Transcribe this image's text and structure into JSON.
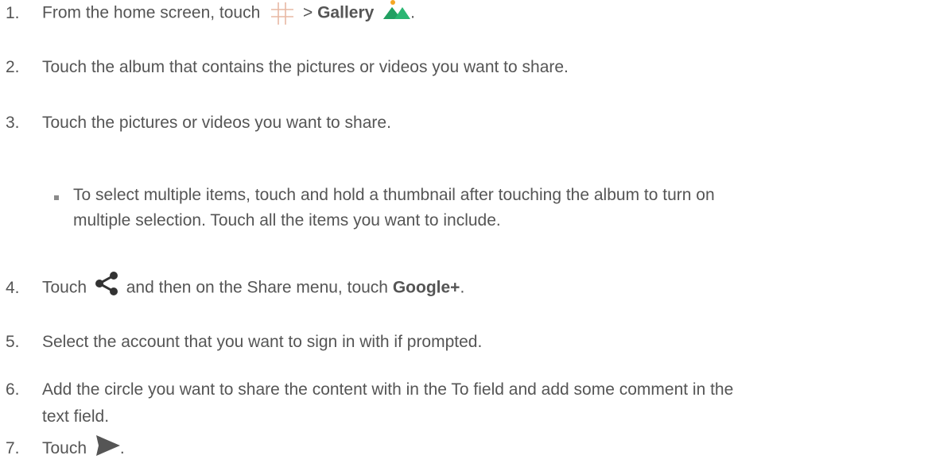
{
  "steps": [
    {
      "num": "1.",
      "pre": "From the home screen, touch",
      "sep": ">",
      "bold": "Gallery",
      "post": "."
    },
    {
      "num": "2.",
      "text": "Touch the album that contains the pictures or videos you want to share."
    },
    {
      "num": "3.",
      "text": "Touch the pictures or videos you want to share."
    },
    {
      "sub_line1": "To select multiple items, touch and hold a thumbnail after touching the album to turn on",
      "sub_line2": "multiple selection. Touch all the items you want to include."
    },
    {
      "num": "4.",
      "pre": "Touch",
      "mid": "and then on the Share menu, touch",
      "bold": "Google+",
      "post": "."
    },
    {
      "num": "5.",
      "text": "Select the account that you want to sign in with if prompted."
    },
    {
      "num": "6.",
      "line1": "Add the circle you want to share the content with in the To field and add some comment in the",
      "line2": "text field."
    },
    {
      "num": "7.",
      "pre": "Touch",
      "post": "."
    }
  ],
  "icons": {
    "apps": "apps-grid-icon",
    "gallery": "gallery-icon",
    "share": "share-icon",
    "send": "send-icon"
  },
  "colors": {
    "text": "#555555",
    "gallery_green": "#2bb673",
    "gallery_orange": "#f5a623"
  }
}
